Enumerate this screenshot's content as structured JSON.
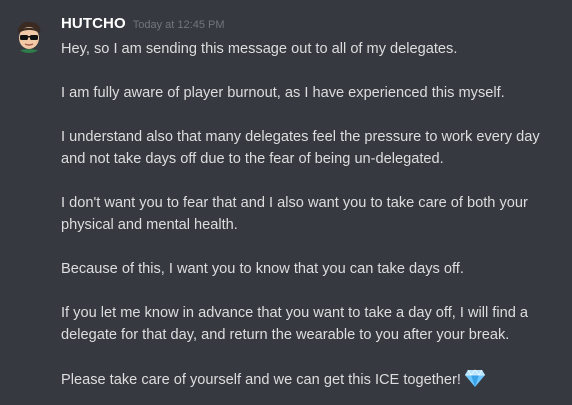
{
  "message": {
    "author": "HUTCHO",
    "timestamp": "Today at 12:45 PM",
    "avatar_icon": "sunglasses-face-icon",
    "paragraphs": [
      [
        "Hey, so I am sending this message out to all of my delegates."
      ],
      [
        "I am fully aware of player burnout, as I have experienced this myself."
      ],
      [
        "I understand also that many delegates feel the pressure to work every day",
        "and not take days off due to the fear of being un-delegated."
      ],
      [
        "I don't want you to fear that and I also want you to take care of both your",
        "physical and mental health."
      ],
      [
        "Because of this, I want you to know that you can take days off."
      ],
      [
        "If you let me know in advance that you want to take a day off, I will find a",
        "delegate for that day, and return the wearable to you after your break."
      ],
      [
        "Please take care of yourself and we can get this ICE together!"
      ]
    ],
    "trailing_emoji": "gem-icon"
  },
  "colors": {
    "background": "#36393f",
    "username": "#ffffff",
    "timestamp": "#72767d",
    "text": "#dcddde",
    "gem": "#6ec6ff"
  }
}
